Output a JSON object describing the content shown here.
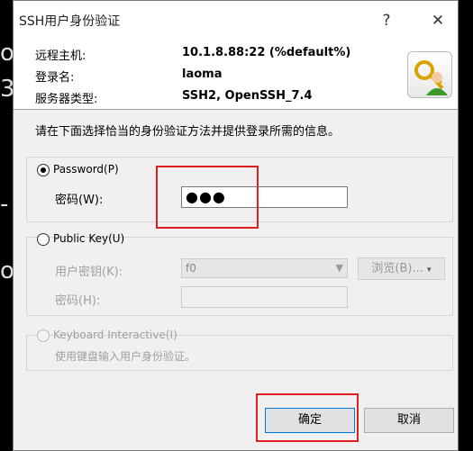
{
  "background_glyphs": [
    "o",
    "3",
    "-",
    "o"
  ],
  "dialog": {
    "title": "SSH用户身份验证",
    "help_button": "?",
    "close_button": "✕"
  },
  "info": {
    "host_label": "远程主机:",
    "host_value": "10.1.8.88:22 (%default%)",
    "login_label": "登录名:",
    "login_value": "laoma",
    "server_type_label": "服务器类型:",
    "server_type_value": "SSH2, OpenSSH_7.4"
  },
  "instruction": "请在下面选择恰当的身份验证方法并提供登录所需的信息。",
  "password_group": {
    "radio_label": "Password(P)",
    "field_label": "密码(W):",
    "field_value": "●●●",
    "selected": true
  },
  "publickey_group": {
    "radio_label": "Public Key(U)",
    "key_label": "用户密钥(K):",
    "key_value": "f0",
    "browse_label": "浏览(B)...",
    "pass_label": "密码(H):",
    "pass_value": ""
  },
  "keyboard_group": {
    "radio_label": "Keyboard Interactive(I)",
    "description": "使用键盘输入用户身份验证。"
  },
  "buttons": {
    "ok": "确定",
    "cancel": "取消"
  },
  "colors": {
    "highlight_box": "#e02020",
    "accent": "#0078d7"
  }
}
